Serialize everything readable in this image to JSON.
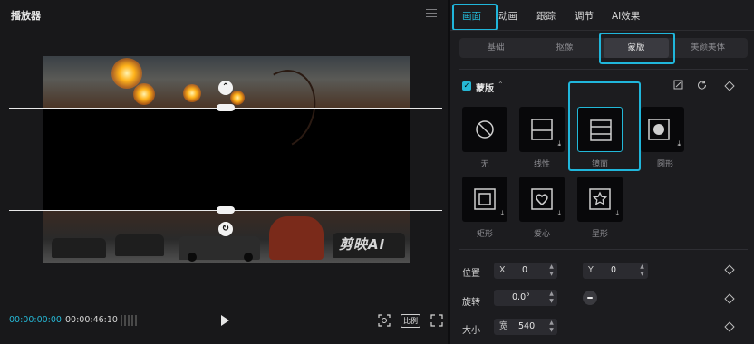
{
  "player": {
    "title": "播放器",
    "watermark": "剪映AI",
    "current_time": "00:00:00:00",
    "total_time": "00:00:46:10",
    "ratio_label": "比例"
  },
  "panel": {
    "tabs": [
      "画面",
      "动画",
      "跟踪",
      "调节",
      "AI效果"
    ],
    "active_tab": "画面",
    "subtabs": [
      "基础",
      "抠像",
      "蒙版",
      "美颜美体"
    ],
    "active_subtab": "蒙版",
    "mask_section": {
      "label": "蒙版",
      "enabled": true,
      "shapes": [
        {
          "label": "无",
          "icon": "none-icon"
        },
        {
          "label": "线性",
          "icon": "linear-mask-icon"
        },
        {
          "label": "镜面",
          "icon": "mirror-mask-icon",
          "selected": true
        },
        {
          "label": "圆形",
          "icon": "circle-mask-icon"
        },
        {
          "label": "矩形",
          "icon": "rectangle-mask-icon"
        },
        {
          "label": "爱心",
          "icon": "heart-mask-icon"
        },
        {
          "label": "星形",
          "icon": "star-mask-icon"
        }
      ]
    },
    "position": {
      "label": "位置",
      "x_key": "X",
      "x": "0",
      "y_key": "Y",
      "y": "0"
    },
    "rotation": {
      "label": "旋转",
      "value": "0.0°"
    },
    "size": {
      "label": "大小",
      "width_key": "宽",
      "width": "540"
    }
  },
  "colors": {
    "accent": "#23b9d9",
    "highlight": "#20b6db",
    "background": "#18181a"
  }
}
